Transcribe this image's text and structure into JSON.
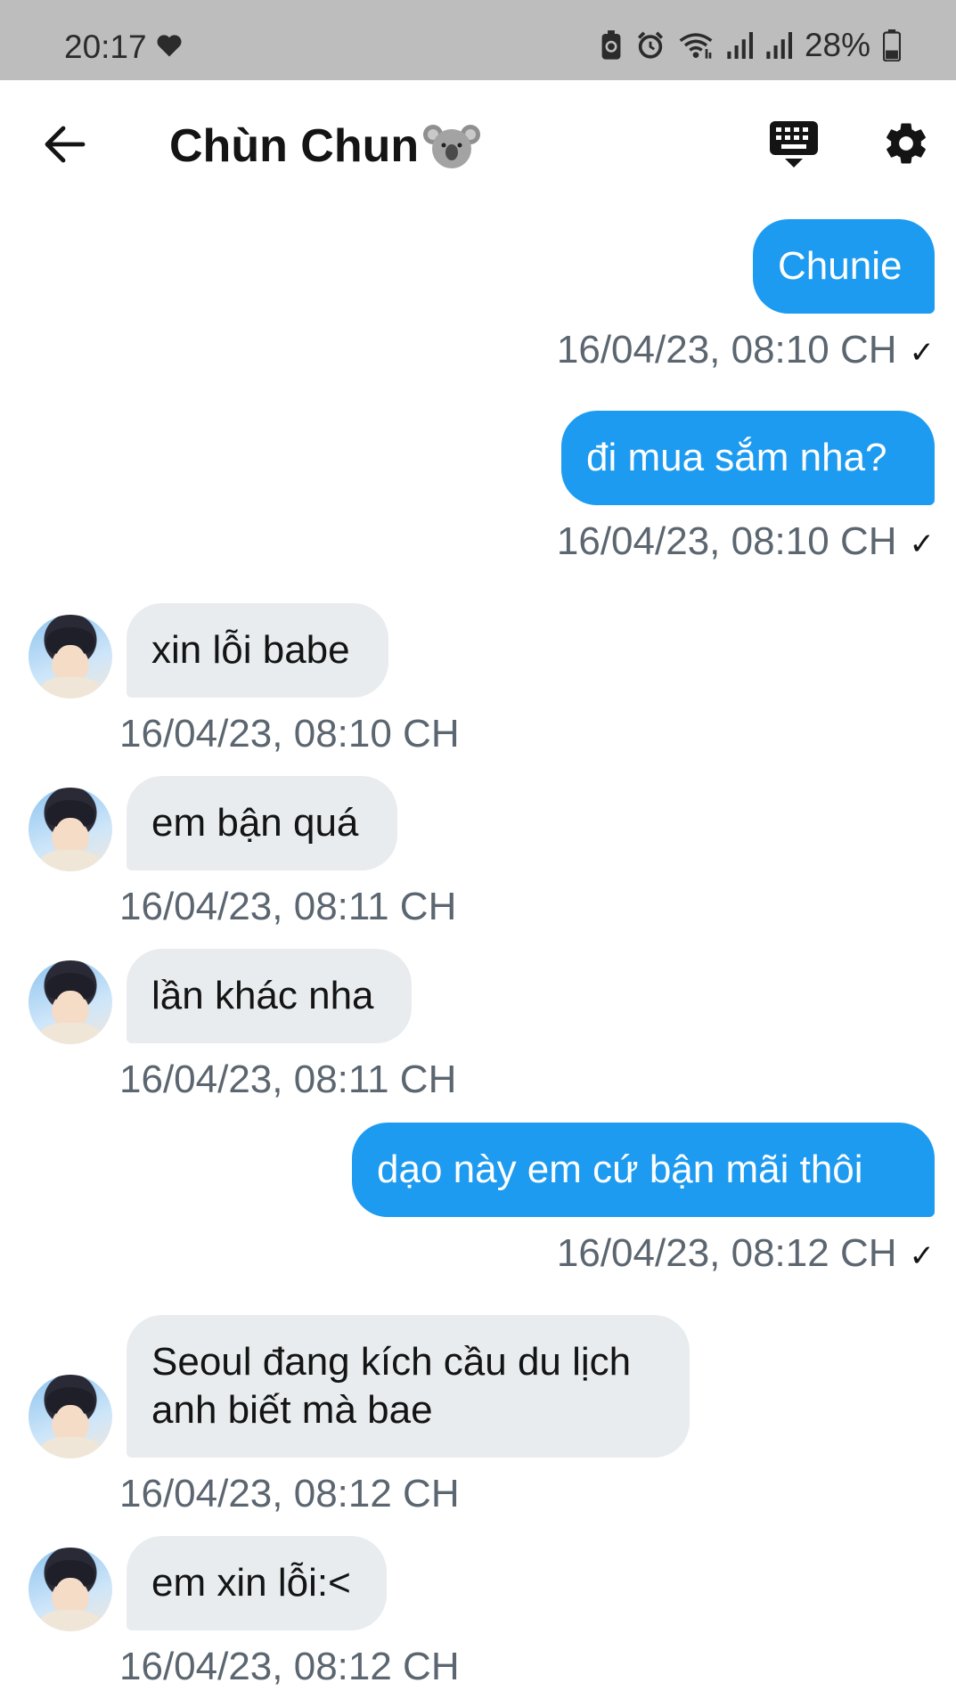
{
  "status_bar": {
    "time": "20:17",
    "battery": "28%",
    "icons": [
      "heart-icon",
      "battery-saver-icon",
      "alarm-icon",
      "wifi-icon",
      "signal-icon",
      "signal-icon",
      "battery-icon"
    ]
  },
  "header": {
    "title": "Chùn Chun",
    "title_emoji": "🐨",
    "icons": [
      "back-arrow-icon",
      "keyboard-icon",
      "gear-icon"
    ]
  },
  "colors": {
    "outgoing_bubble": "#1d9bf0",
    "incoming_bubble": "#e8ecef",
    "timestamp": "#5b6670"
  },
  "messages": [
    {
      "direction": "out",
      "text": "Chunie",
      "time": "16/04/23, 08:10 CH",
      "read": "✓"
    },
    {
      "direction": "out",
      "text": "đi mua sắm nha?",
      "time": "16/04/23, 08:10 CH",
      "read": "✓"
    },
    {
      "direction": "in",
      "text": "xin lỗi babe",
      "time": "16/04/23, 08:10 CH"
    },
    {
      "direction": "in",
      "text": "em bận quá",
      "time": "16/04/23, 08:11 CH"
    },
    {
      "direction": "in",
      "text": "lần khác nha",
      "time": "16/04/23, 08:11 CH"
    },
    {
      "direction": "out",
      "text": "dạo này em cứ bận mãi thôi",
      "time": "16/04/23, 08:12 CH",
      "read": "✓"
    },
    {
      "direction": "in",
      "text": "Seoul đang kích cầu du lịch anh biết mà bae",
      "time": "16/04/23, 08:12 CH"
    },
    {
      "direction": "in",
      "text": "em xin lỗi:<",
      "time": "16/04/23, 08:12 CH"
    }
  ]
}
